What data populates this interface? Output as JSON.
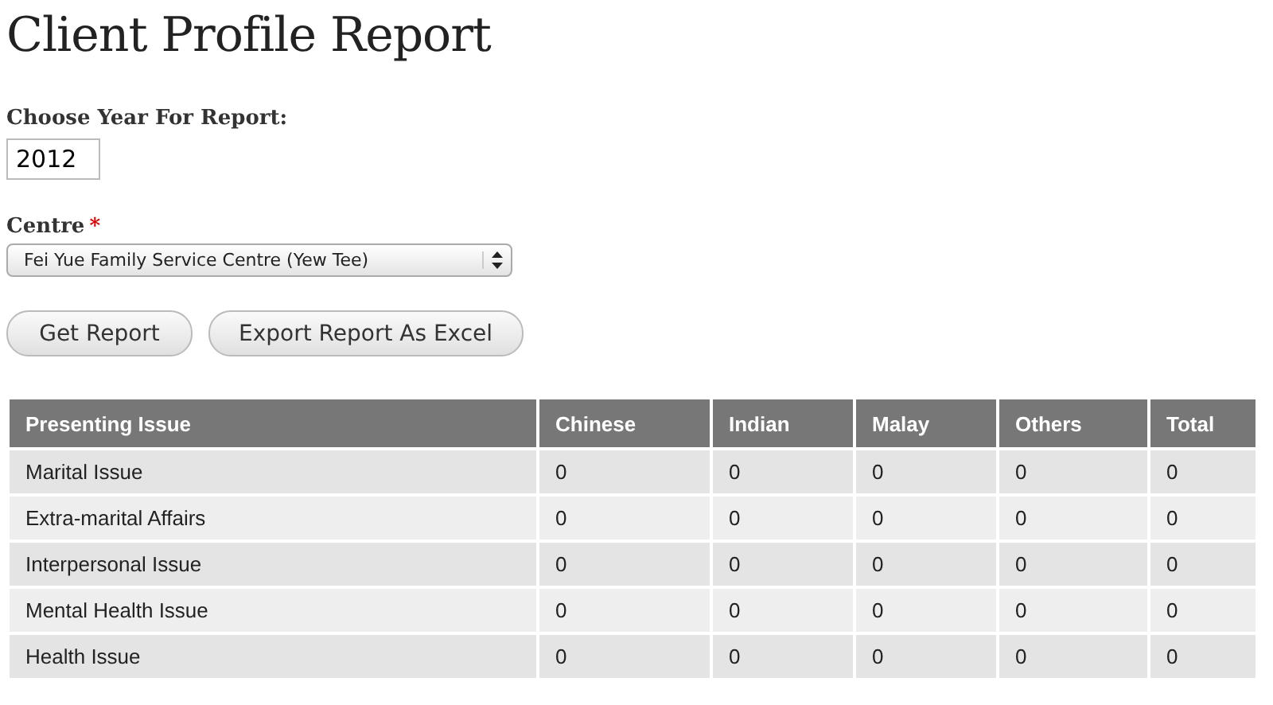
{
  "page_title": "Client Profile Report",
  "year_field": {
    "label": "Choose Year For Report:",
    "value": "2012"
  },
  "centre_field": {
    "label": "Centre",
    "required_mark": "*",
    "value": "Fei Yue Family Service Centre (Yew Tee)"
  },
  "buttons": [
    "Get Report",
    "Export Report As Excel"
  ],
  "table": {
    "columns": [
      "Presenting Issue",
      "Chinese",
      "Indian",
      "Malay",
      "Others",
      "Total"
    ],
    "rows": [
      [
        "Marital Issue",
        "0",
        "0",
        "0",
        "0",
        "0"
      ],
      [
        "Extra-marital Affairs",
        "0",
        "0",
        "0",
        "0",
        "0"
      ],
      [
        "Interpersonal Issue",
        "0",
        "0",
        "0",
        "0",
        "0"
      ],
      [
        "Mental Health Issue",
        "0",
        "0",
        "0",
        "0",
        "0"
      ],
      [
        "Health Issue",
        "0",
        "0",
        "0",
        "0",
        "0"
      ]
    ]
  }
}
